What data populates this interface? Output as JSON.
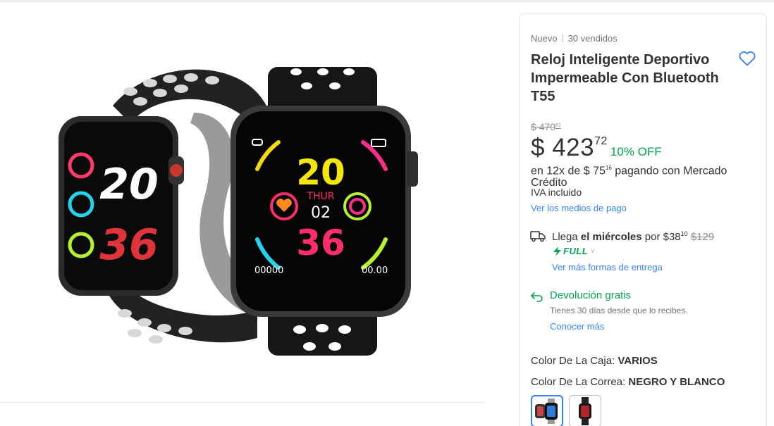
{
  "product": {
    "condition": "Nuevo",
    "sold": "30 vendidos",
    "title": "Reloj Inteligente Deportivo Impermeable Con Bluetooth T55",
    "image_alt": "Smartwatch T55 negro y blanco"
  },
  "watch_face": {
    "left": {
      "hour": "20",
      "minute": "36"
    },
    "right": {
      "hour": "20",
      "day": "THUR",
      "date": "02",
      "minute": "36",
      "steps": "00000",
      "distance": "00.00"
    }
  },
  "pricing": {
    "old_currency": "$",
    "old_int": "470",
    "old_cents": "81",
    "currency": "$",
    "price_int": "423",
    "price_cents": "72",
    "discount": "10% OFF",
    "installments_pre": "en 12x de $ 75",
    "installments_cents": "16",
    "installments_post": " pagando con Mercado Crédito",
    "tax": "IVA incluido",
    "payment_link": "Ver los medios de pago"
  },
  "shipping": {
    "prefix": "Llega ",
    "day": "el miércoles",
    "by": " por $38",
    "price_cents": "10",
    "old_price": "$129",
    "badge": "FULL",
    "more_link": "Ver más formas de entrega"
  },
  "returns": {
    "title": "Devolución gratis",
    "desc": "Tienes 30 días desde que lo recibes.",
    "link": "Conocer más"
  },
  "attributes": {
    "case_label": "Color De La Caja: ",
    "case_value": "VARIOS",
    "strap_label": "Color De La Correa: ",
    "strap_value": "NEGRO Y BLANCO"
  },
  "colors": {
    "accent": "#3483fa",
    "green": "#00a650"
  }
}
